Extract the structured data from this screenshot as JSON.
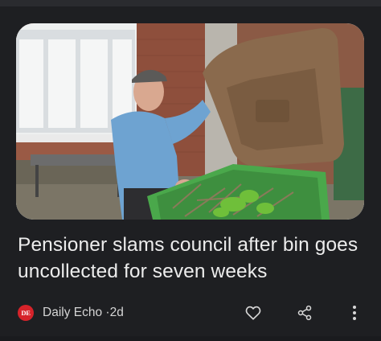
{
  "article": {
    "headline": "Pensioner slams council after bin goes uncollected for seven weeks",
    "image_alt": "Pensioner holding open the lid of a brown garden waste bin full of cuttings"
  },
  "source": {
    "logo_text": "DE",
    "publisher": "Daily Echo",
    "separator": "·",
    "age": "2d",
    "logo_color": "#d6232a"
  },
  "actions": {
    "like_icon": "heart-outline-icon",
    "share_icon": "share-icon",
    "more_icon": "vertical-dots-icon"
  },
  "colors": {
    "background": "#1e1f22",
    "headline_text": "#ececec",
    "meta_text": "#d5d5d5"
  }
}
